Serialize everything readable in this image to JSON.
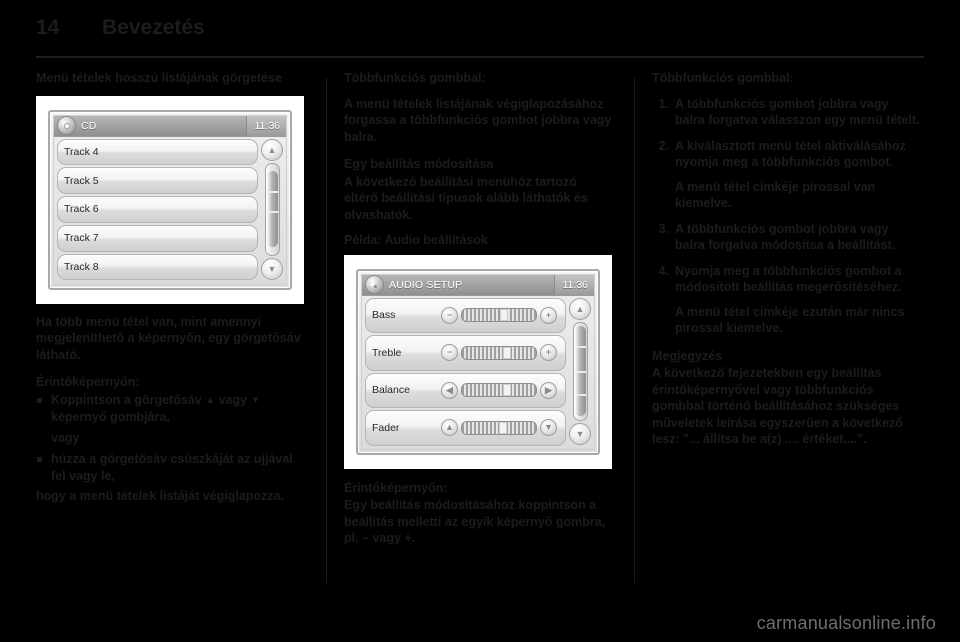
{
  "header": {
    "page_number": "14",
    "title": "Bevezetés"
  },
  "column1": {
    "heading": "Menü tételek hosszú listájának görgetése",
    "screenshot": {
      "titlebar": {
        "icon": "cd-disc-icon",
        "title": "CD",
        "clock": "11:36"
      },
      "list_items": [
        "Track 4",
        "Track 5",
        "Track 6",
        "Track 7",
        "Track 8"
      ],
      "scroll_up_icon": "chevron-up-icon",
      "scroll_down_icon": "chevron-down-icon"
    },
    "paragraph1": "Ha több menü tétel van, mint amennyi megjeleníthető a képernyőn, egy görgetősáv látható.",
    "subheading": "Érintőképernyőn:",
    "bullet1_pre": "Koppintson a görgetősáv ",
    "bullet1_up": "▲",
    "bullet1_mid": " vagy ",
    "bullet1_down": "▼",
    "bullet1_post": " képernyő gombjára,",
    "or_word": "vagy",
    "bullet2": "húzza a görgetősáv csúszkáját az ujjával fel vagy le,",
    "paragraph2": "hogy a menü tételek listáját végiglapozza."
  },
  "column2": {
    "heading": "Többfunkciós gombbal:",
    "paragraph1": "A menü tételek listájának végiglapozásához forgassa a többfunkciós gombot jobbra vagy balra.",
    "subheading1": "Egy beállítás módosítása",
    "paragraph2": "A következő beállítási menühöz tartozó eltérő beállítási típusok alább láthatók és olvashatók.",
    "example_label": "Példa: Audio beállítások",
    "screenshot": {
      "titlebar": {
        "icon": "audio-note-icon",
        "title": "AUDIO SETUP",
        "clock": "11:36"
      },
      "rows": [
        {
          "label": "Bass",
          "left_icon": "minus-icon",
          "right_icon": "plus-icon",
          "knob_percent": 52
        },
        {
          "label": "Treble",
          "left_icon": "minus-icon",
          "right_icon": "plus-icon",
          "knob_percent": 56
        },
        {
          "label": "Balance",
          "left_icon": "chevron-left-icon",
          "right_icon": "chevron-right-icon",
          "knob_percent": 56
        },
        {
          "label": "Fader",
          "left_icon": "chevron-up-icon",
          "right_icon": "chevron-down-icon",
          "knob_percent": 50
        }
      ],
      "scroll_up_icon": "chevron-up-icon",
      "scroll_down_icon": "chevron-down-icon"
    },
    "subheading2": "Érintőképernyőn:",
    "paragraph3": "Egy beállítás módosításához koppintson a beállítás melletti az egyik képernyő gombra, pl. – vagy +."
  },
  "column3": {
    "heading": "Többfunkciós gombbal:",
    "steps": [
      {
        "num": "1.",
        "text": "A többfunkciós gombot jobbra vagy balra forgatva válasszon egy menü tételt.",
        "sub": ""
      },
      {
        "num": "2.",
        "text": "A kiválasztott menü tétel aktiválásához nyomja meg a többfunkciós gombot.",
        "sub": "A menü tétel címkéje pirossal van kiemelve."
      },
      {
        "num": "3.",
        "text": "A többfunkciós gombot jobbra vagy balra forgatva módosítsa a beállítást.",
        "sub": ""
      },
      {
        "num": "4.",
        "text": "Nyomja meg a többfunkciós gombot a módosított beállítás megerősítéséhez.",
        "sub": "A menü tétel címkéje ezután már nincs pirossal kiemelve."
      }
    ],
    "note_heading": "Megjegyzés",
    "note_text": "A következő fejezetekben egy beállítás érintőképernyővel vagy többfunkciós gombbal történő beállításához szükséges műveletek leírása egyszerűen a következő lesz: \"... állítsa be a(z) .... értéket....\"."
  },
  "watermark": "carmanualsonline.info"
}
